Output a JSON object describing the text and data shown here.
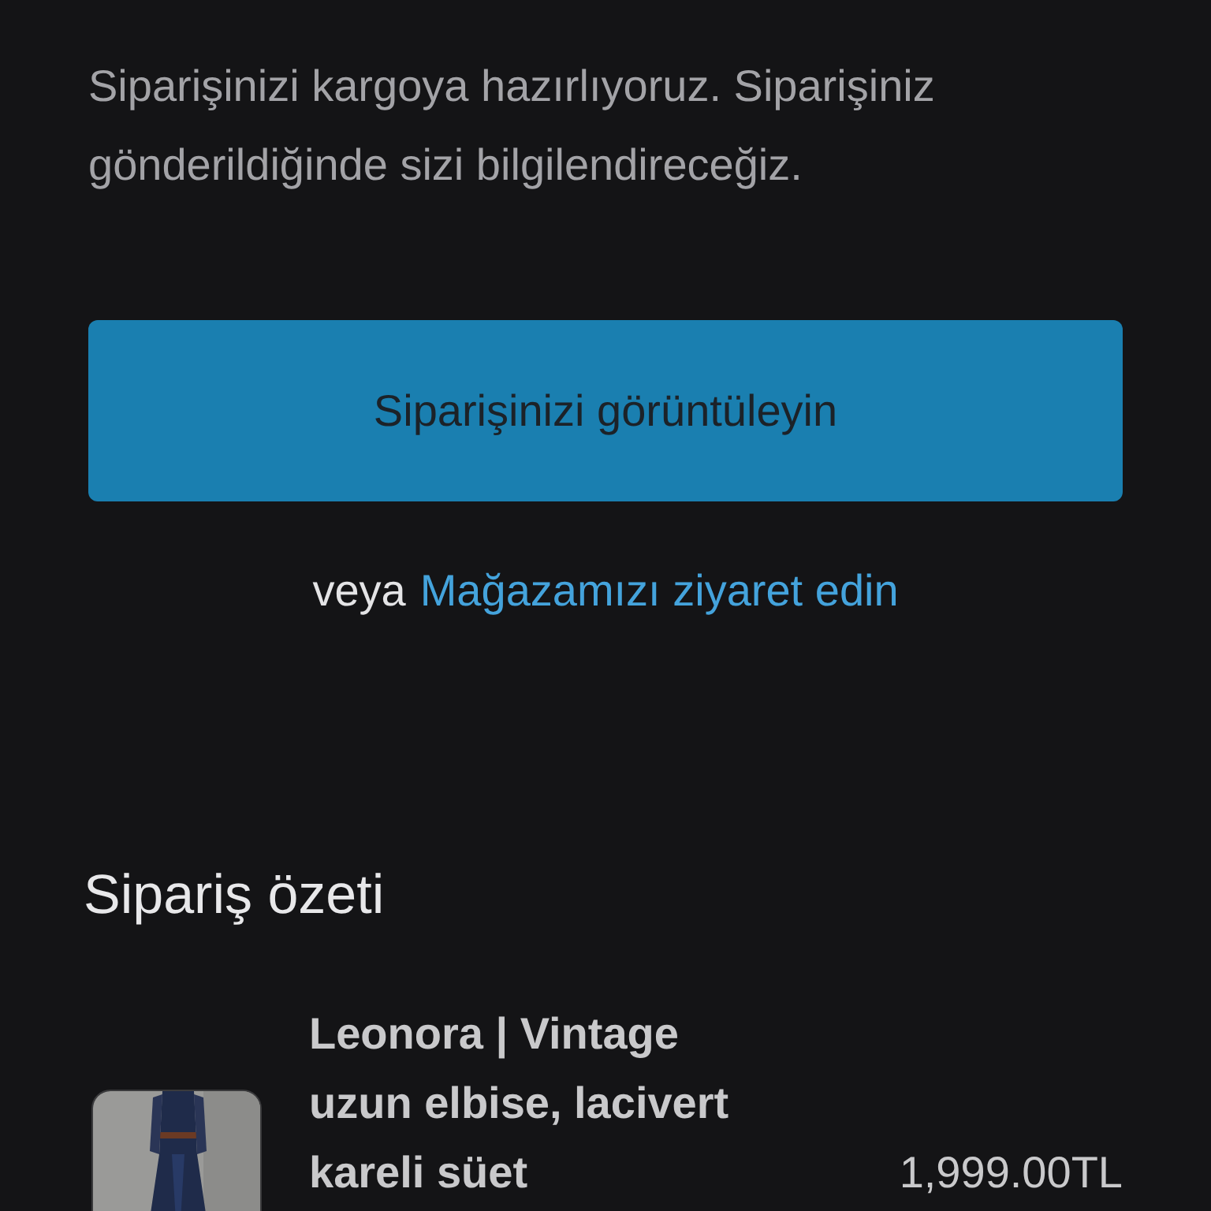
{
  "message": "Siparişinizi kargoya hazırlıyoruz. Siparişiniz gönderildiğinde sizi bilgilendireceğiz.",
  "view_order_button": "Siparişinizi görüntüleyin",
  "alternative": {
    "prefix": "veya",
    "link": "Mağazamızı ziyaret edin"
  },
  "order_summary": {
    "title": "Sipariş özeti",
    "items": [
      {
        "name": "Leonora | Vintage uzun elbise, lacivert kareli süet",
        "price": "1,999.00TL"
      }
    ]
  }
}
